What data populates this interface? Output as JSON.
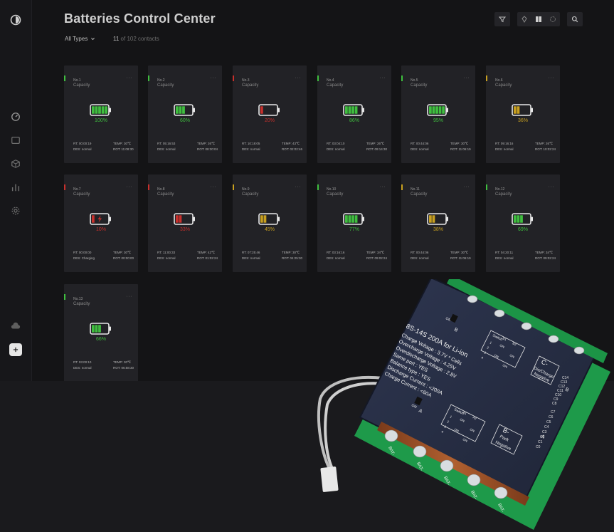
{
  "app": {
    "title": "Batteries Control Center"
  },
  "filter": {
    "label": "All Types",
    "shown": "11",
    "of_text": "of 102 contacts"
  },
  "colors": {
    "green": "#3fbf3f",
    "red": "#c8302c",
    "yellow": "#c8a020"
  },
  "cards": [
    {
      "no": "No.1",
      "cap": "Capacity",
      "pct": "100%",
      "status": "green",
      "level": 1.0,
      "charging": false,
      "rt": "RT: 00:00:19",
      "temp": "TEMP: 30℃",
      "des": "DES: normal",
      "rot": "ROT: 11:08:30"
    },
    {
      "no": "No.2",
      "cap": "Capacity",
      "pct": "60%",
      "status": "green",
      "level": 0.6,
      "charging": false,
      "rt": "RT: 05:16:53",
      "temp": "TEMP: 26℃",
      "des": "DES: normal",
      "rot": "ROT: 08:30:04"
    },
    {
      "no": "No.3",
      "cap": "Capacity",
      "pct": "20%",
      "status": "red",
      "level": 0.2,
      "charging": false,
      "rt": "RT: 10:18:05",
      "temp": "TEMP: 43℃",
      "des": "DES: normal",
      "rot": "ROT: 02:02:46"
    },
    {
      "no": "No.4",
      "cap": "Capacity",
      "pct": "86%",
      "status": "green",
      "level": 0.86,
      "charging": false,
      "rt": "RT: 03:04:10",
      "temp": "TEMP: 26℃",
      "des": "DES: normal",
      "rot": "ROT: 09:14:30"
    },
    {
      "no": "No.5",
      "cap": "Capacity",
      "pct": "95%",
      "status": "green",
      "level": 0.95,
      "charging": false,
      "rt": "RT: 00:44:06",
      "temp": "TEMP: 30℃",
      "des": "DES: normal",
      "rot": "ROT: 11:06:19"
    },
    {
      "no": "No.6",
      "cap": "Capacity",
      "pct": "36%",
      "status": "yellow",
      "level": 0.36,
      "charging": false,
      "rt": "RT: 09:16:16",
      "temp": "TEMP: 26℃",
      "des": "DES: normal",
      "rot": "ROT: 10:02:24"
    },
    {
      "no": "No.7",
      "cap": "Capacity",
      "pct": "10%",
      "status": "red",
      "level": 0.1,
      "charging": true,
      "rt": "RT: 00:00:00",
      "temp": "TEMP: 30℃",
      "des": "DES: Charging",
      "rot": "ROT: 00:00:00"
    },
    {
      "no": "No.8",
      "cap": "Capacity",
      "pct": "33%",
      "status": "red",
      "level": 0.33,
      "charging": false,
      "rt": "RT: 11:00:33",
      "temp": "TEMP: 42℃",
      "des": "DES: normal",
      "rot": "ROT: 01:02:24"
    },
    {
      "no": "No.9",
      "cap": "Capacity",
      "pct": "45%",
      "status": "yellow",
      "level": 0.45,
      "charging": false,
      "rt": "RT: 07:25:46",
      "temp": "TEMP: 30℃",
      "des": "DES: normal",
      "rot": "ROT: 04:25:30"
    },
    {
      "no": "No.10",
      "cap": "Capacity",
      "pct": "77%",
      "status": "green",
      "level": 0.77,
      "charging": false,
      "rt": "RT: 03:16:16",
      "temp": "TEMP: 34℃",
      "des": "DES: normal",
      "rot": "ROT: 09:02:24"
    },
    {
      "no": "No.11",
      "cap": "Capacity",
      "pct": "38%",
      "status": "yellow",
      "level": 0.38,
      "charging": false,
      "rt": "RT: 00:44:06",
      "temp": "TEMP: 30℃",
      "des": "DES: normal",
      "rot": "ROT: 11:06:19"
    },
    {
      "no": "No.12",
      "cap": "Capacity",
      "pct": "69%",
      "status": "green",
      "level": 0.69,
      "charging": false,
      "rt": "RT: 04:20:11",
      "temp": "TEMP: 34℃",
      "des": "DES: normal",
      "rot": "ROT: 09:02:24"
    },
    {
      "no": "No.13",
      "cap": "Capacity",
      "pct": "66%",
      "status": "green",
      "level": 0.66,
      "charging": false,
      "rt": "RT: 03:00:10",
      "temp": "TEMP: 30℃",
      "des": "DES: normal",
      "rot": "ROT: 06:58:30"
    }
  ],
  "board": {
    "model": "8S-14S 200A for Li-ion",
    "specs": [
      "Charge Voltage : 3.7V * Cells",
      "Overcharge Voltage : 4.25V",
      "Overdischarge Voltage : 2.8V",
      "Same port : YES",
      "Balance type : YES",
      "Discharge Current : <200A",
      "Charge Current : <60A"
    ],
    "c_neg": [
      "C-",
      "Dis/Charge",
      "Negative"
    ],
    "b_neg": [
      "B-",
      "Pack",
      "Negative"
    ],
    "port_b": "B",
    "port_a": "A",
    "on_b": "ON",
    "on_a": "ON",
    "switch_b_label": "Switch",
    "switch_a_label": "Switch",
    "bat_labels": [
      "BAT-",
      "BAT-",
      "BAT-",
      "BAT-",
      "BAT-"
    ],
    "c_pins": [
      "C14",
      "C13",
      "C12",
      "C11",
      "C10",
      "C9",
      "C8"
    ],
    "cb_pins": [
      "C7",
      "C6",
      "C5",
      "C4",
      "C3",
      "C2",
      "C1",
      "C0"
    ],
    "table_b": [
      "B1",
      "B2",
      "1",
      "2",
      "3",
      "4",
      "ON",
      "ON",
      "ON",
      "ON"
    ],
    "table_a": [
      "A1",
      "A2",
      "1",
      "2",
      "3",
      "4",
      "ON",
      "ON",
      "ON",
      "ON"
    ],
    "edge_b": "B",
    "edge_a": "A"
  }
}
